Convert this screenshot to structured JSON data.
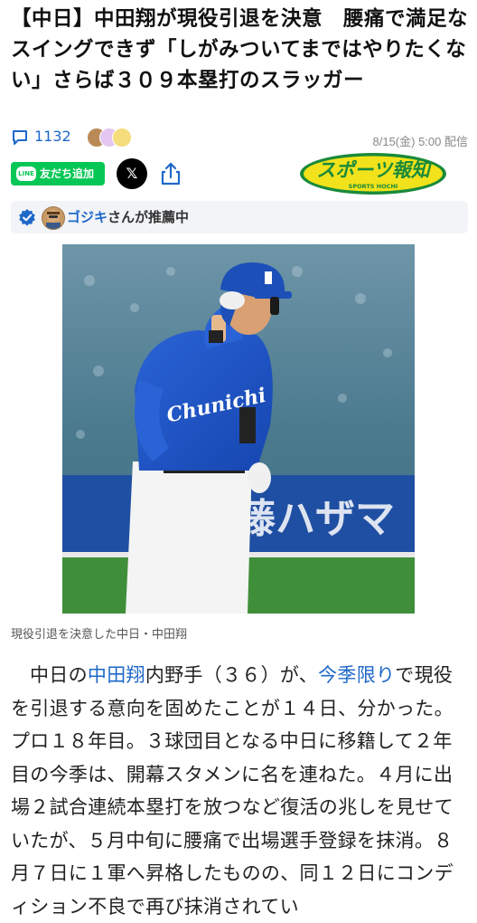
{
  "article": {
    "title": "【中日】中田翔が現役引退を決意　腰痛で満足なスイングできず「しがみついてまではやりたくない」さらば３０９本塁打のスラッガー",
    "comment_count": "1132",
    "date": "8/15(金) 5:00 配信"
  },
  "share": {
    "line_label": "友だち追加",
    "line_logo": "LINE",
    "x_label": "𝕏",
    "brand_name": "スポーツ報知",
    "brand_sub": "SPORTS HOCHI"
  },
  "recommend": {
    "name": "ゴジキ",
    "suffix": "さんが推薦中"
  },
  "photo": {
    "caption": "現役引退を決意した中日・中田翔",
    "jersey_text": "Chunichi",
    "banner_text": "藤ハザマ"
  },
  "body": {
    "p1_a": "中日の",
    "p1_link1": "中田翔",
    "p1_b": "内野手（３６）が、",
    "p1_link2": "今季限り",
    "p1_c": "で現役を引退する意向を固めたことが１４日、分かった。プロ１８年目。３球団目となる中日に移籍して２年目の今季は、開幕スタメンに名を連ねた。４月に出場２試合連続本塁打を放つなど復活の兆しを見せていたが、５月中旬に腰痛で出場選手登録を抹消。８月７日に１軍へ昇格したものの、同１２日にコンディション不良で再び抹消されてい"
  },
  "colors": {
    "link": "#1e68c9",
    "line_green": "#06c755",
    "brand_yellow": "#f2e21b",
    "brand_green": "#1a8a3a"
  }
}
